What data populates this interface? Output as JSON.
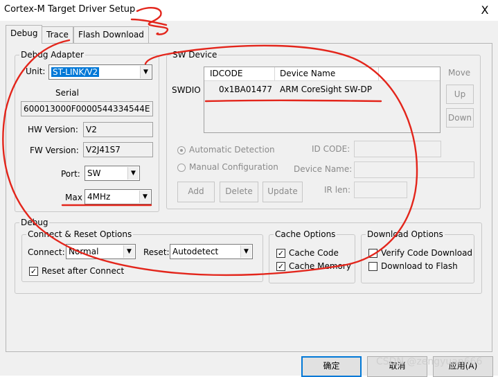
{
  "window": {
    "title": "Cortex-M Target Driver Setup",
    "close_glyph": "X"
  },
  "tabs": [
    {
      "label": "Debug",
      "active": true
    },
    {
      "label": "Trace",
      "active": false
    },
    {
      "label": "Flash Download",
      "active": false
    }
  ],
  "debug_adapter": {
    "legend": "Debug Adapter",
    "unit_label": "Unit:",
    "unit_value": "ST-LINK/V2",
    "serial_label": "Serial",
    "serial_value": "600013000F0000544334544E",
    "hw_label": "HW Version:",
    "hw_value": "V2",
    "fw_label": "FW Version:",
    "fw_value": "V2J41S7",
    "port_label": "Port:",
    "port_value": "SW",
    "max_label": "Max",
    "max_value": "4MHz"
  },
  "sw_device": {
    "legend": "SW Device",
    "swdio_label": "SWDIO",
    "columns": [
      "IDCODE",
      "Device Name"
    ],
    "rows": [
      {
        "idcode": "0x1BA01477",
        "device_name": "ARM CoreSight SW-DP"
      }
    ],
    "move_label": "Move",
    "up_label": "Up",
    "down_label": "Down",
    "auto_detect_label": "Automatic Detection",
    "manual_config_label": "Manual Configuration",
    "id_code_label": "ID CODE:",
    "device_name_label": "Device Name:",
    "ir_len_label": "IR len:",
    "add_label": "Add",
    "delete_label": "Delete",
    "update_label": "Update"
  },
  "debug": {
    "legend": "Debug",
    "connect_reset": {
      "legend": "Connect & Reset Options",
      "connect_label": "Connect:",
      "connect_value": "Normal",
      "reset_label": "Reset:",
      "reset_value": "Autodetect",
      "reset_after_connect_label": "Reset after Connect",
      "reset_after_connect_checked": true
    },
    "cache": {
      "legend": "Cache Options",
      "cache_code_label": "Cache Code",
      "cache_code_checked": true,
      "cache_memory_label": "Cache Memory",
      "cache_memory_checked": true
    },
    "download": {
      "legend": "Download Options",
      "verify_label": "Verify Code Download",
      "verify_checked": false,
      "download_flash_label": "Download to Flash",
      "download_flash_checked": false
    }
  },
  "footer": {
    "ok_label": "确定",
    "cancel_label": "取消",
    "apply_label": "应用(A)"
  },
  "watermark": "CSDN @zengyuan666",
  "colors": {
    "annotation": "#e3251b",
    "selection": "#0078d7",
    "dialog_bg": "#f0f0f0"
  }
}
